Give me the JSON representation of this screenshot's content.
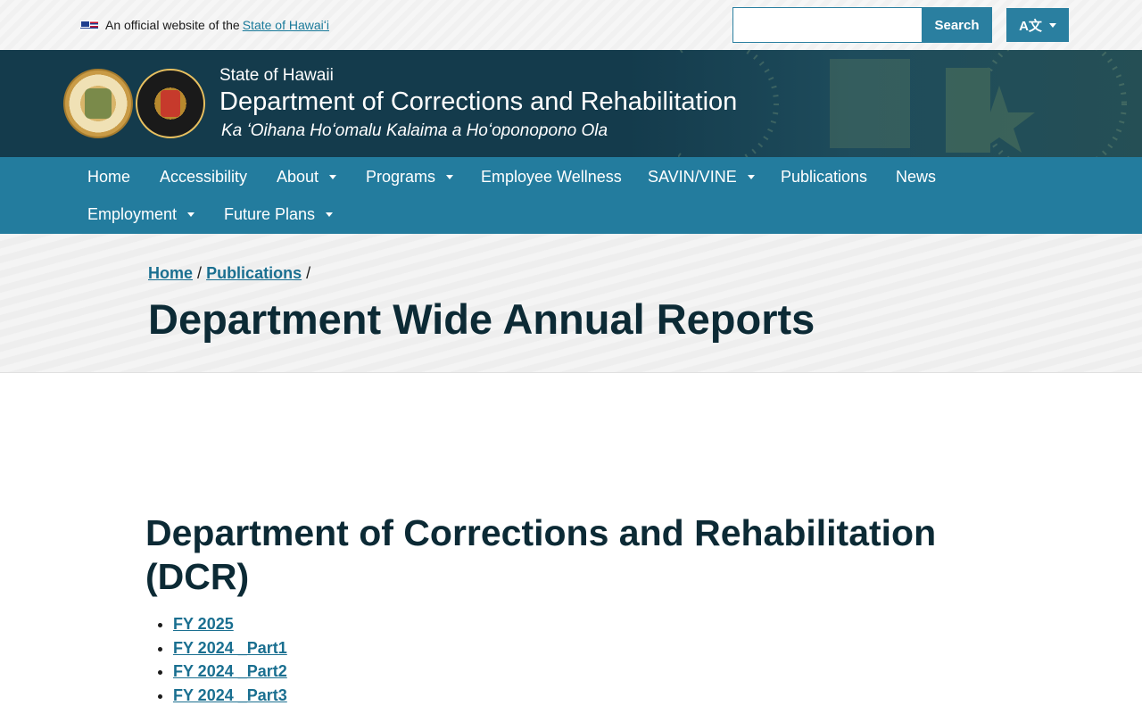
{
  "topbar": {
    "official_prefix": "An official website of the",
    "official_link": "State of Hawaiʻi",
    "search_placeholder": "",
    "search_label": "Search",
    "translate_label": "A文"
  },
  "header": {
    "state": "State of Hawaii",
    "title": "Department of Corrections and Rehabilitation",
    "subtitle": "Ka ʻOihana Hoʻomalu Kalaima a Hoʻoponopono Ola"
  },
  "nav": {
    "items": [
      {
        "label": "Home",
        "dropdown": false
      },
      {
        "label": "Accessibility",
        "dropdown": false
      },
      {
        "label": "About",
        "dropdown": true
      },
      {
        "label": "Programs",
        "dropdown": true
      },
      {
        "label": "Employee Wellness",
        "dropdown": false
      },
      {
        "label": "SAVIN/VINE",
        "dropdown": true
      },
      {
        "label": "Publications",
        "dropdown": false
      },
      {
        "label": "News",
        "dropdown": false
      },
      {
        "label": "Employment",
        "dropdown": true
      },
      {
        "label": "Future Plans",
        "dropdown": true
      }
    ]
  },
  "breadcrumb": {
    "items": [
      "Home",
      "Publications"
    ],
    "separator": "/"
  },
  "page": {
    "title": "Department Wide Annual Reports"
  },
  "section": {
    "title": "Department of Corrections and Rehabilitation (DCR)",
    "reports": [
      "FY 2025",
      "FY 2024 _Part1",
      "FY 2024 _Part2",
      "FY 2024 _Part3"
    ]
  },
  "colors": {
    "nav_bg": "#237c9e",
    "header_bg": "#143b4c",
    "link": "#1a6f90",
    "heading": "#0c2a35"
  }
}
